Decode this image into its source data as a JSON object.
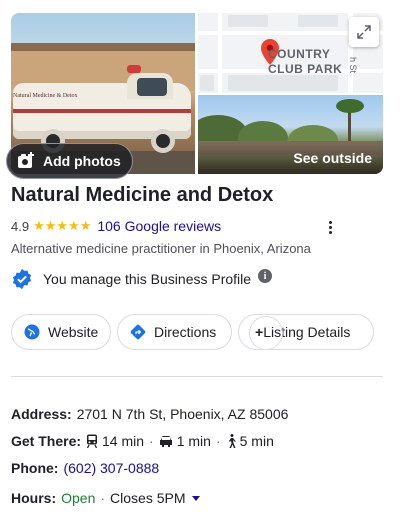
{
  "photos": {
    "add_photos_label": "Add photos",
    "see_outside_label": "See outside",
    "van_text": "Natural Medicine & Detox",
    "map_label_line1": "COUNTRY",
    "map_label_line2": "CLUB PARK",
    "map_street": "h St"
  },
  "business": {
    "name": "Natural Medicine and Detox",
    "rating": "4.9",
    "stars": "★★★★★",
    "reviews": "106 Google reviews",
    "category": "Alternative medicine practitioner in Phoenix, Arizona",
    "manage_text": "You manage this Business Profile",
    "info_glyph": "i"
  },
  "actions": {
    "website": "Website",
    "directions": "Directions",
    "listing_plus": "+",
    "listing": "Listing Details"
  },
  "details": {
    "address_label": "Address:",
    "address_value": "2701 N 7th St, Phoenix, AZ 85006",
    "get_there_label": "Get There:",
    "transit_time": "14 min",
    "drive_time": "1 min",
    "walk_time": "5 min",
    "sep": "·",
    "phone_label": "Phone:",
    "phone_value": "(602) 307-0888",
    "hours_label": "Hours:",
    "hours_status": "Open",
    "hours_closes": "Closes 5PM"
  },
  "colors": {
    "link": "#1a0dab",
    "open": "#188038",
    "star": "#fbbc04",
    "verified": "#1a73e8",
    "pin": "#ea4335"
  }
}
